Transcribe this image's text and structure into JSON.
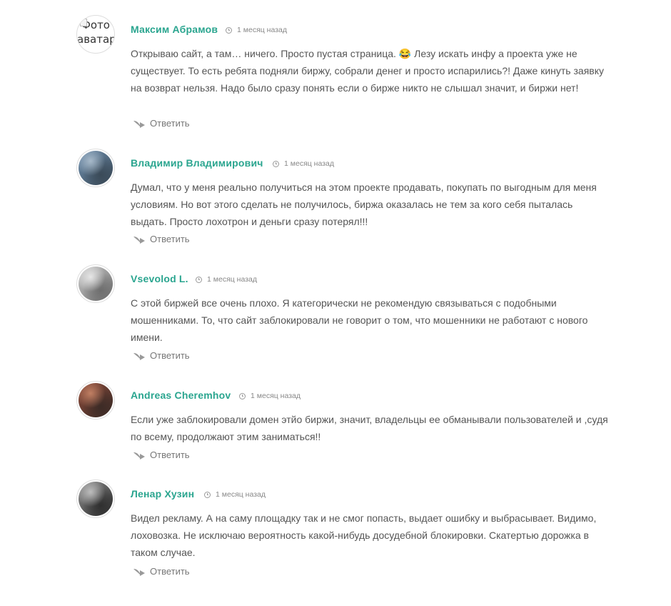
{
  "comments": [
    {
      "author": "Максим Абрамов",
      "time": "1 месяц назад",
      "avatar_alt": "Фото аватара",
      "avatar_colors": null,
      "text": "Открываю сайт, а там… ничего. Просто пустая страница. 😂 Лезу искать инфу а проекта уже не существует. То есть ребята подняли биржу, собрали денег и просто испарились?! Даже кинуть заявку на возврат нельзя. Надо было сразу понять если о бирже никто не слышал значит, и биржи нет!",
      "reply_label": "Ответить"
    },
    {
      "author": "Владимир Владимирович",
      "time": "1 месяц назад",
      "avatar_colors": [
        "#6f8fae",
        "#3a4a58",
        "#a7b9c9"
      ],
      "text": "Думал, что у меня реально получиться на этом проекте продавать, покупать по выгодным для меня условиям. Но вот этого сделать не получилось, биржа оказалась не тем за кого себя пыталась выдать. Просто лохотрон и деньги сразу потерял!!!",
      "reply_label": "Ответить"
    },
    {
      "author": "Vsevolod L.",
      "time": "1 месяц назад",
      "avatar_colors": [
        "#c9c9c9",
        "#6e6e6e",
        "#e6e6e6"
      ],
      "text": "С этой биржей все очень плохо. Я категорически не рекомендую связываться с подобными мошенниками. То, что сайт заблокировали не говорит о том, что мошенники не работают с нового имени.",
      "reply_label": "Ответить"
    },
    {
      "author": "Andreas Cheremhov",
      "time": "1 месяц назад",
      "avatar_colors": [
        "#8a4a3a",
        "#3c2b26",
        "#c07f63"
      ],
      "text": "Если уже заблокировали домен этйо биржи, значит, владельцы ее обманывали пользователей и ,судя по всему, продолжают этим заниматься!!",
      "reply_label": "Ответить"
    },
    {
      "author": "Ленар Хузин",
      "time": "1 месяц назад",
      "avatar_colors": [
        "#8c8c8c",
        "#2f2f2f",
        "#bdbdbd"
      ],
      "text": "Видел рекламу. А на саму площадку так и не смог попасть, выдает ошибку и выбрасывает. Видимо, лоховозка. Не исключаю вероятность какой-нибудь досудебной блокировки. Скатертью дорожка в таком случае.",
      "reply_label": "Ответить"
    }
  ]
}
